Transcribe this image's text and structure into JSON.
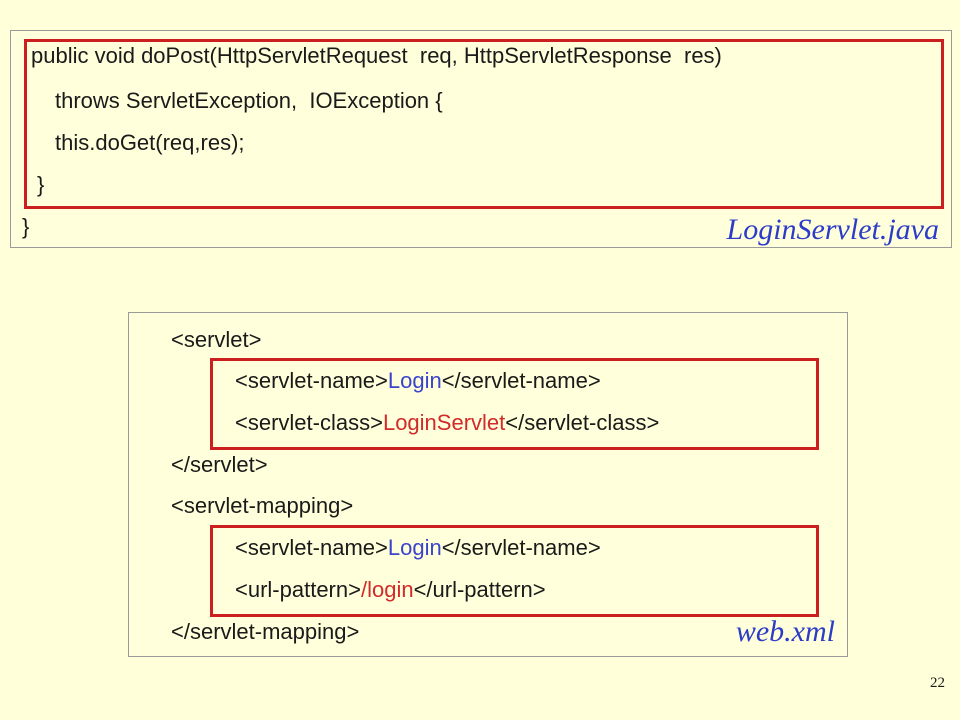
{
  "java_panel": {
    "lines": [
      "public void doPost(HttpServletRequest  req, HttpServletResponse  res)",
      "throws ServletException,  IOException {",
      "this.doGet(req,res);",
      "}",
      "}"
    ],
    "caption": "LoginServlet.java"
  },
  "xml_panel": {
    "servlet_open": "<servlet>",
    "servlet_name_open": "<servlet-name>",
    "servlet_name_value": "Login",
    "servlet_name_close": "</servlet-name>",
    "servlet_class_open": "<servlet-class>",
    "servlet_class_value": "LoginServlet",
    "servlet_class_close": "</servlet-class>",
    "servlet_close": "</servlet>",
    "mapping_open": "<servlet-mapping>",
    "mapping_name_open": "<servlet-name>",
    "mapping_name_value": "Login",
    "mapping_name_close": "</servlet-name>",
    "url_pattern_open": "<url-pattern>",
    "url_pattern_value": "/login",
    "url_pattern_close": "</url-pattern>",
    "mapping_close": "</servlet-mapping>",
    "caption": "web.xml"
  },
  "page_number": "22",
  "colors": {
    "background": "#ffffd9",
    "highlight_border": "#cc1f1f",
    "servlet_name_value": "#3a45cc",
    "class_value": "#d12b2b",
    "caption": "#2c3cc8"
  }
}
